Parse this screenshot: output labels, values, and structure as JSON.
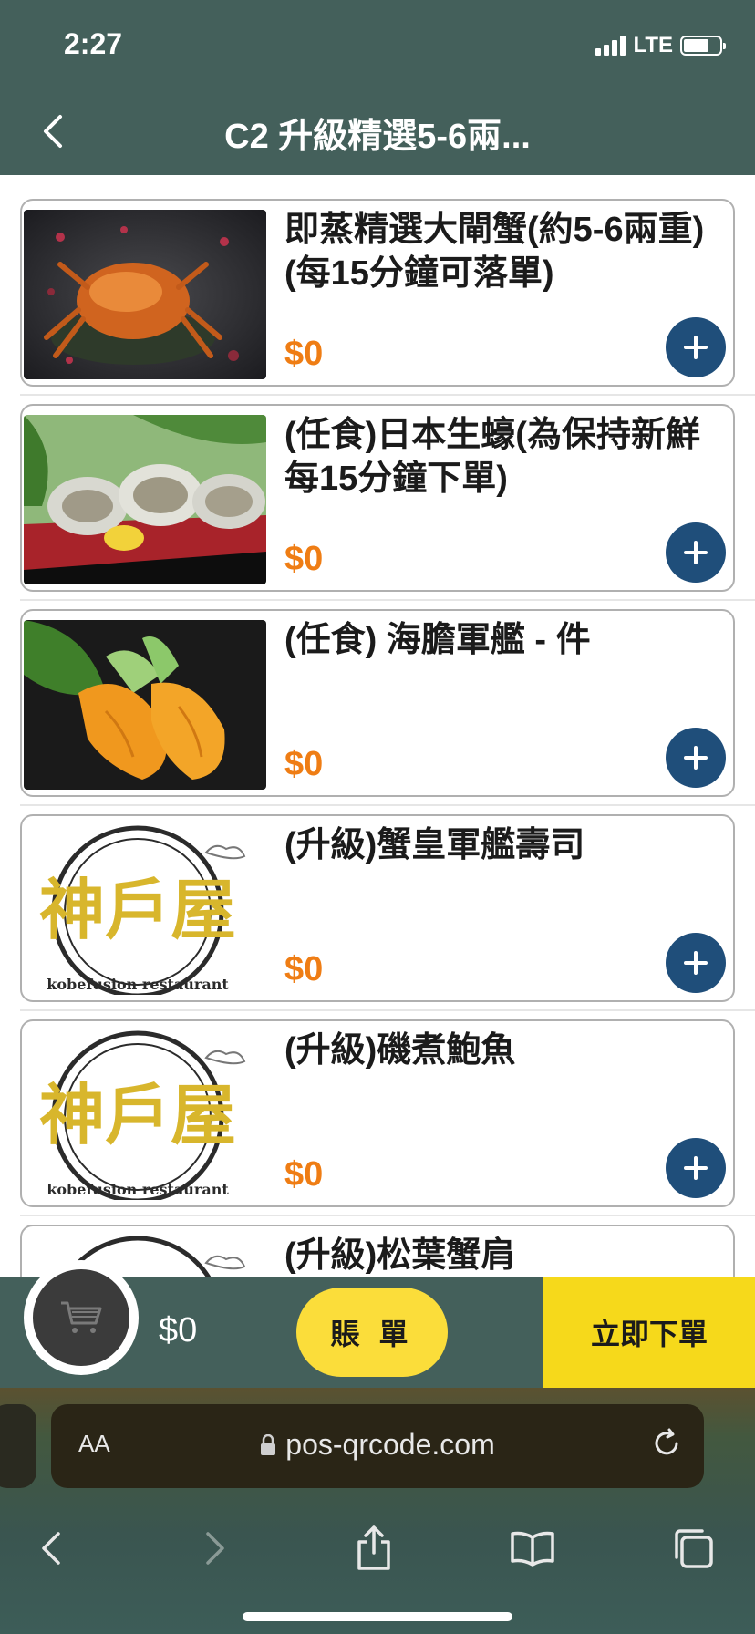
{
  "status": {
    "time": "2:27",
    "network": "LTE"
  },
  "nav": {
    "title": "C2 升級精選5-6兩..."
  },
  "items": [
    {
      "name": "即蒸精選大閘蟹(約5-6兩重)(每15分鐘可落單)",
      "price": "$0",
      "image": "steamed-crab-photo"
    },
    {
      "name": "(任食)日本生蠔(為保持新鮮每15分鐘下單)",
      "price": "$0",
      "image": "oyster-photo"
    },
    {
      "name": "(任食) 海膽軍艦 - 件",
      "price": "$0",
      "image": "sea-urchin-photo"
    },
    {
      "name": "(升級)蟹皇軍艦壽司",
      "price": "$0",
      "image": "restaurant-logo"
    },
    {
      "name": "(升級)磯煮鮑魚",
      "price": "$0",
      "image": "restaurant-logo"
    },
    {
      "name": "(升級)松葉蟹肩",
      "price": "$0",
      "image": "restaurant-logo"
    }
  ],
  "logo_text": {
    "main": "神戶屋",
    "sub": "kobefusion restaurant"
  },
  "cart": {
    "total": "$0",
    "bill_label": "賬 單",
    "order_label": "立即下單"
  },
  "browser": {
    "text_size": "AA",
    "url": "pos-qrcode.com"
  },
  "colors": {
    "header": "#44605b",
    "price": "#ef7d14",
    "add_button": "#1f4e7a",
    "bill_button": "#fbdd3a",
    "order_button": "#f6d91b"
  }
}
